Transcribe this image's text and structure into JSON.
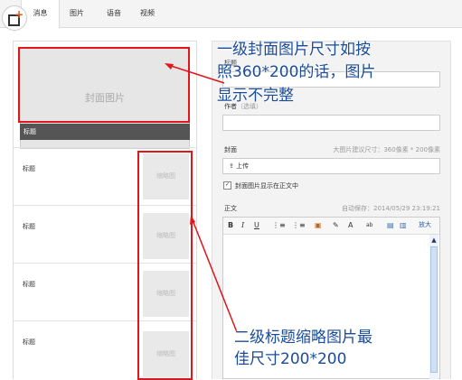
{
  "tabs": [
    {
      "label": "消息",
      "active": true
    },
    {
      "label": "图片",
      "active": false
    },
    {
      "label": "语音",
      "active": false
    },
    {
      "label": "视频",
      "active": false
    }
  ],
  "left": {
    "cover_placeholder": "封面图片",
    "cover_title": "标题",
    "rows": [
      {
        "title": "标题",
        "thumb": "缩略图"
      },
      {
        "title": "标题",
        "thumb": "缩略图"
      },
      {
        "title": "标题",
        "thumb": "缩略图"
      },
      {
        "title": "标题",
        "thumb": "缩略图"
      }
    ]
  },
  "form": {
    "title_label": "标题",
    "author_label": "作者",
    "author_hint": "（选填）",
    "cover_label": "封面",
    "cover_size_hint": "大图片建议尺寸：360像素 * 200像素",
    "upload_label": "上传",
    "show_cover_label": "封面图片显示在正文中",
    "body_label": "正文",
    "autosave": "自动保存：2014/05/29 23:19:21",
    "toolbar": {
      "bold": "B",
      "italic": "I",
      "underline": "U",
      "list1": "⋮≡",
      "list2": "⋮≡",
      "image": "▣",
      "pen": "✎",
      "font_color": "A",
      "highlight": "ab",
      "doc": "▤",
      "doc2": "▥",
      "enlarge": "放大"
    }
  },
  "annotations": {
    "top_line1": "一级封面图片尺寸如按",
    "top_line2": "照360*200的话，图片",
    "top_line3": "显示不完整",
    "bottom_line1": "二级标题缩略图片最",
    "bottom_line2": "佳尺寸200*200"
  },
  "colors": {
    "annotation_text": "#1a4c99",
    "highlight_box": "#e0161b",
    "logo_accent": "#e0561c"
  }
}
